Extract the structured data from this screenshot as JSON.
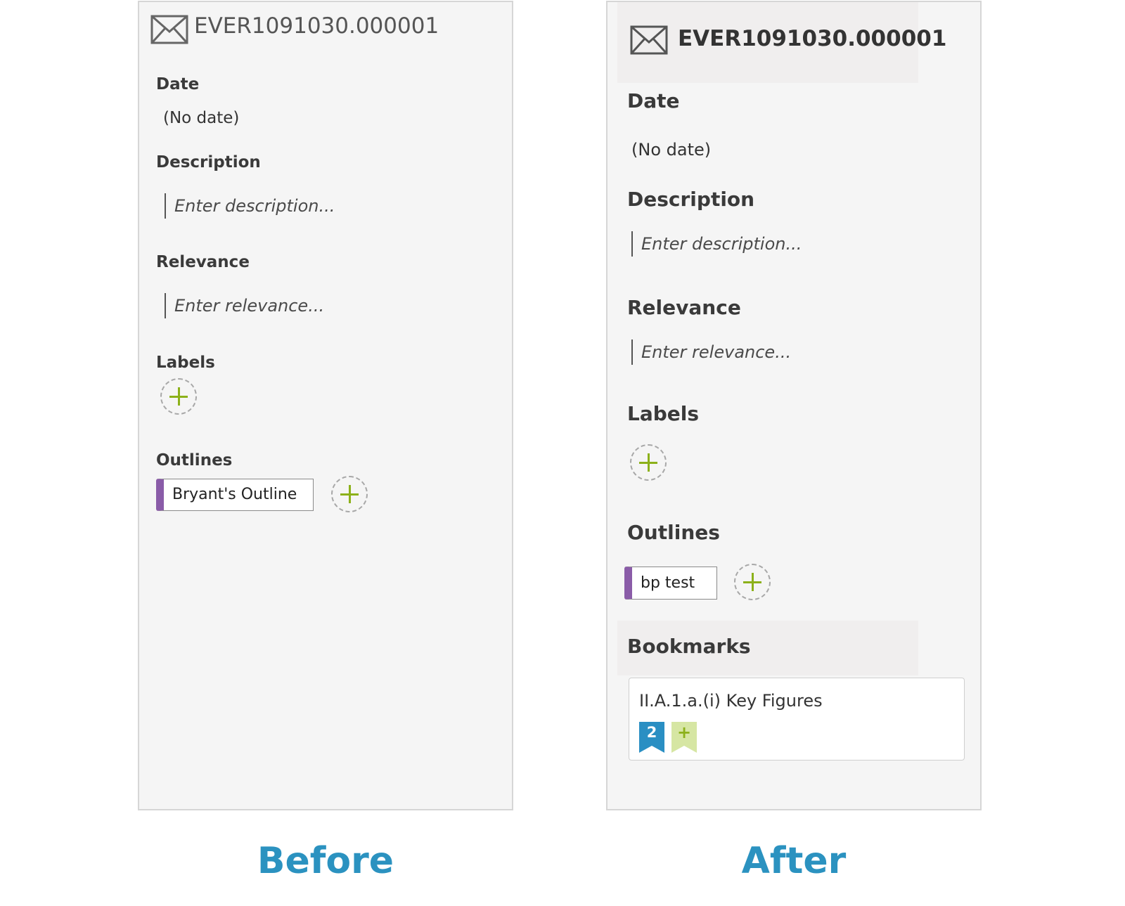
{
  "before": {
    "doc_id": "EVER1091030.000001",
    "date_label": "Date",
    "date_value": "(No date)",
    "description_label": "Description",
    "description_placeholder": "Enter description...",
    "relevance_label": "Relevance",
    "relevance_placeholder": "Enter relevance...",
    "labels_label": "Labels",
    "outlines_label": "Outlines",
    "outline_chip": "Bryant's Outline",
    "caption": "Before"
  },
  "after": {
    "doc_id": "EVER1091030.000001",
    "date_label": "Date",
    "date_value": "(No date)",
    "description_label": "Description",
    "description_placeholder": "Enter description...",
    "relevance_label": "Relevance",
    "relevance_placeholder": "Enter relevance...",
    "labels_label": "Labels",
    "outlines_label": "Outlines",
    "outline_chip": "bp test",
    "bookmarks_label": "Bookmarks",
    "bookmark_title": "II.A.1.a.(i) Key Figures",
    "bookmark_count": "2",
    "bookmark_add_symbol": "+",
    "caption": "After"
  },
  "colors": {
    "caption": "#2b92c0",
    "outline_accent": "#8a5ca8",
    "add_plus": "#8cb11a",
    "bookmark_blue": "#2a8fc3",
    "bookmark_add_bg": "#d6e6a3"
  },
  "icons": [
    "envelope-icon",
    "add-circle-icon",
    "bookmark-count-icon",
    "bookmark-add-icon"
  ]
}
